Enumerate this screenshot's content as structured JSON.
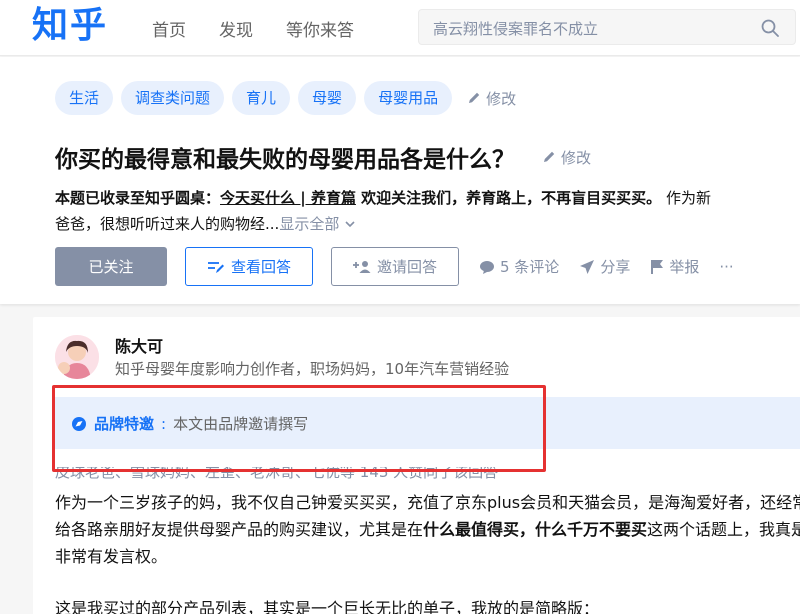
{
  "header": {
    "logo": "知乎",
    "nav": [
      "首页",
      "发现",
      "等你来答"
    ],
    "search_placeholder": "高云翔性侵案罪名不成立"
  },
  "question": {
    "topics": [
      "生活",
      "调查类问题",
      "育儿",
      "母婴",
      "母婴用品"
    ],
    "topic_edit": "修改",
    "title": "你买的最得意和最失败的母婴用品各是什么？",
    "title_edit": "修改",
    "desc_prefix": "本题已收录至知乎圆桌：",
    "desc_link": "今天买什么 | 养育篇",
    "desc_bold": " 欢迎关注我们，养育路上，不再盲目买买买。",
    "desc_rest": " 作为新",
    "desc_line2": "爸爸，很想听听过来人的购物经...",
    "show_all": "显示全部",
    "followed": "已关注",
    "view_answers": "查看回答",
    "invite": "邀请回答",
    "comments": "5 条评论",
    "share": "分享",
    "report": "举报",
    "more": "···"
  },
  "answer": {
    "author": "陈大可",
    "bio": "知乎母婴年度影响力创作者，职场妈妈，10年汽车营销经验",
    "brand_label": "品牌特邀",
    "brand_text": "本文由品牌邀请撰写",
    "voters": "皮球老爸、雪球妈妈、左歪、老沐哥、七优等 143 人赞同了该回答",
    "body_1": "作为一个三岁孩子的妈，我不仅自己钟爱买买买，充值了京东plus会员和天猫会员，是海淘爱好者，还经常给各路亲朋好友提供母婴产品的购买建议，尤其是在",
    "body_1_bold": "什么最值得买，什么千万不要买",
    "body_1_end": "这两个话题上，我真是非常有发言权。",
    "body_2": "这是我买过的部分产品列表，其实是一个巨长无比的单子，我放的是简略版："
  },
  "colors": {
    "brand_blue": "#1772f6",
    "highlight_red": "#e53131",
    "muted": "#8590a6"
  }
}
